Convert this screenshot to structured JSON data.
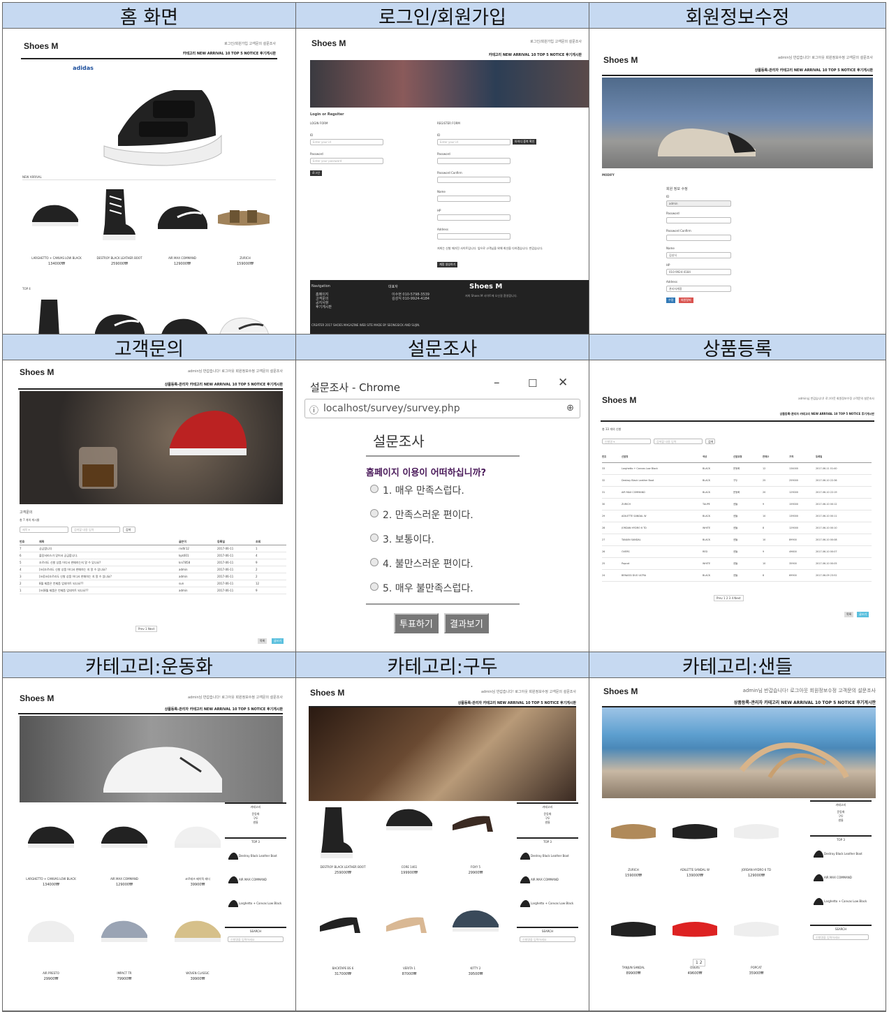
{
  "headers": [
    "홈 화면",
    "로그인/회원가입",
    "회원정보수정",
    "고객문의",
    "설문조사",
    "상품등록",
    "카테고리:운동화",
    "카테고리:구두",
    "카테고리:샌들"
  ],
  "brand": "Shoes M",
  "toplinks": {
    "guest": "로그인/회원가입   고객문의   설문조사",
    "admin": "admin님 반갑습니다!  로그아웃  회원정보수정  고객문의  설문조사"
  },
  "nav": {
    "guest": "카테고리   NEW ARRIVAL 10   TOP 5   NOTICE   후기게시판",
    "admin": "상품등록-관리자   카테고리   NEW ARRIVAL 10   TOP 5   NOTICE   후기게시판"
  },
  "home": {
    "logo": "adidas",
    "new_arrival": "NEW ARRIVAL",
    "top4": "TOP 4",
    "products": [
      {
        "name": "LARGHETTO + CANVAS LOW BLACK",
        "price": "134000₩"
      },
      {
        "name": "DESTROY BLACK LEATHER BOOT",
        "price": "259000₩"
      },
      {
        "name": "AIR MAX COMMAND",
        "price": "129000₩"
      },
      {
        "name": "ZURICH",
        "price": "159000₩"
      }
    ]
  },
  "login": {
    "title": "Login or Regsiter",
    "login_form": "LOGIN FORM",
    "register_form": "REGISTER FORM",
    "id": "ID",
    "password": "Password",
    "id_ph": "Enter your id",
    "pw_ph": "Enter your password",
    "login_btn": "로그인",
    "check_btn": "아이디 중복 확인",
    "pw_confirm": "Password Confirm",
    "name": "Name",
    "hp": "HP",
    "address": "Address",
    "notice": "저희는 신발 매거진 사이트입니다. 앞으로 고객님을 위해 최선을 다하겠습니다. 반갑습니다.",
    "register_btn": "계정 생성하기",
    "footer_nav": "Navigation",
    "footer_links": "홈페이지\n고객문의\n공지사항\n후기게시판",
    "footer_rep": "대표자",
    "footer_names": "이수현 010-5798-3539\n김성식 010-9924-4184",
    "footer_brand": "Shoes M",
    "footer_desc": "저희 Shoes M 사이트에 오신걸 환영합니다.",
    "footer_credit": "CREATER 2017 SHOES MAGAZINE WEB SITE MADE BY SEONGSICK AND SUJIN."
  },
  "modify": {
    "section": "MODIFY",
    "title": "회원 정보 수정",
    "id_label": "ID",
    "id_val": "admin",
    "password": "Password",
    "pw_confirm": "Password Confirm",
    "name": "Name",
    "name_val": "김성식",
    "hp": "HP",
    "hp_val": "010-9924-4184",
    "address": "Address",
    "address_val": "관리자계정",
    "btn1": "수정",
    "btn2": "회원탈퇴"
  },
  "inquiry": {
    "title": "고객문의",
    "count": "총 7 개의 게시물",
    "cols": [
      "번호",
      "제목",
      "글쓴이",
      "등록일",
      "조회"
    ],
    "rows": [
      [
        "7",
        "궁금합니다",
        "rndtr12",
        "2017-06-11",
        "1"
      ],
      [
        "6",
        "출장서비스가 있어서 궁금합니다.",
        "kyk001",
        "2017-06-11",
        "4"
      ],
      [
        "5",
        "조르라도 신발 상품 어디서 판매하는지 알 수 있나요?",
        "kni7858",
        "2017-06-11",
        "9"
      ],
      [
        "4",
        "[re]조르라도 신발 상품 어디서 판매하는 지 알 수 있나요?",
        "admin",
        "2017-06-11",
        "2"
      ],
      [
        "3",
        "[re][re]조르라도 신발 상품 어디서 판매하는 지 알 수 있나요?",
        "admin",
        "2017-06-11",
        "2"
      ],
      [
        "2",
        "8월 제품은 언제쯤 업데이트 되나요??",
        "sun",
        "2017-06-11",
        "12"
      ],
      [
        "1",
        "[re]8월 제품은 언제쯤 업데이트 되나요??",
        "admin",
        "2017-06-11",
        "9"
      ]
    ],
    "pager": "Prev  1  Next",
    "btn": "글쓰기"
  },
  "survey": {
    "window_title": "설문조사 - Chrome",
    "url": "localhost/survey/survey.php",
    "heading": "설문조사",
    "question": "홈페이지 이용이 어떠하십니까?",
    "options": [
      "1. 매우 만족스럽다.",
      "2. 만족스러운 편이다.",
      "3. 보통이다.",
      "4. 불만스러운 편이다.",
      "5. 매우 불만족스럽다."
    ],
    "vote": "투표하기",
    "result": "결과보기"
  },
  "product_admin": {
    "count": "총 33 개의 신발",
    "cols": [
      "번호",
      "신발명",
      "색상",
      "신발유형",
      "판매수",
      "가격",
      "등록일"
    ],
    "rows": [
      [
        "33",
        "Larghetto + Canvas Low Black",
        "BLACK",
        "운동화",
        "12",
        "134000",
        "2017-06-11 01:40"
      ],
      [
        "32",
        "Destroy Black Leather Boot",
        "BLACK",
        "구두",
        "25",
        "259000",
        "2017-06-10 22:36"
      ],
      [
        "31",
        "AIR MAX COMMAND",
        "BLACK",
        "운동화",
        "20",
        "129000",
        "2017-06-10 22:19"
      ],
      [
        "30",
        "ZURICH",
        "TAUPE",
        "샌들",
        "9",
        "159000",
        "2017-06-10 00:12"
      ],
      [
        "29",
        "ADILETTE SANDAL W",
        "BLACK",
        "샌들",
        "10",
        "139000",
        "2017-06-10 00:11"
      ],
      [
        "28",
        "JORDAN HYDRO 6 TD",
        "WHITE",
        "샌들",
        "8",
        "129000",
        "2017-06-10 00:10"
      ],
      [
        "27",
        "TANJUN SANDAL",
        "BLACK",
        "샌들",
        "10",
        "89900",
        "2017-06-10 00:08"
      ],
      [
        "26",
        "OVERS",
        "RED",
        "샌들",
        "9",
        "49600",
        "2017-06-10 00:07"
      ],
      [
        "25",
        "Popcat",
        "WHITE",
        "샌들",
        "10",
        "35900",
        "2017-06-10 00:05"
      ],
      [
        "24",
        "BENASSI DUO ULTRA",
        "BLACK",
        "샌들",
        "8",
        "69900",
        "2017-06-09 23:52"
      ]
    ],
    "pager": "Prev  1  2  3  4  Next",
    "btn1": "목록",
    "btn2": "글쓰기"
  },
  "sneakers": {
    "products": [
      {
        "name": "LARGHETTO + CANVAS LOW BLACK",
        "price": "134000₩"
      },
      {
        "name": "AIR MAX COMMAND",
        "price": "129000₩"
      },
      {
        "name": "코르테즈 베이직 레더",
        "price": "39900₩"
      },
      {
        "name": "AIR PRESTO",
        "price": "29900₩"
      },
      {
        "name": "IMPACT TR",
        "price": "79900₩"
      },
      {
        "name": "WOVEN CLASSIC",
        "price": "39900₩"
      }
    ]
  },
  "shoes": {
    "products": [
      {
        "name": "DESTROY BLACK LEATHER BOOT",
        "price": "259000₩"
      },
      {
        "name": "CORE 1461",
        "price": "199900₩"
      },
      {
        "name": "FOXY 5",
        "price": "29900₩"
      },
      {
        "name": "BACKTAPE BS 6",
        "price": "317000₩"
      },
      {
        "name": "VERITA 1",
        "price": "87000₩"
      },
      {
        "name": "KITTY 2",
        "price": "39500₩"
      }
    ]
  },
  "sandals": {
    "products": [
      {
        "name": "ZURICH",
        "price": "159000₩"
      },
      {
        "name": "ADILETTE SANDAL W",
        "price": "139000₩"
      },
      {
        "name": "JORDAN HYDRO 6 TD",
        "price": "129000₩"
      },
      {
        "name": "TANJUN SANDAL",
        "price": "89900₩"
      },
      {
        "name": "OVERS",
        "price": "49600₩"
      },
      {
        "name": "POPCAT",
        "price": "35900₩"
      }
    ],
    "pager": "1  2"
  },
  "sidebar": {
    "category": "카테고리",
    "items": "운동화\n구두\n샌들",
    "top3": "TOP 3",
    "top3_items": [
      "Destroy Black Leather Boot",
      "AIR MAX COMMAND",
      "Larghetto + Canvas Low Black"
    ],
    "search": "SEARCH",
    "search_ph": "신발명을 입력하세요"
  }
}
